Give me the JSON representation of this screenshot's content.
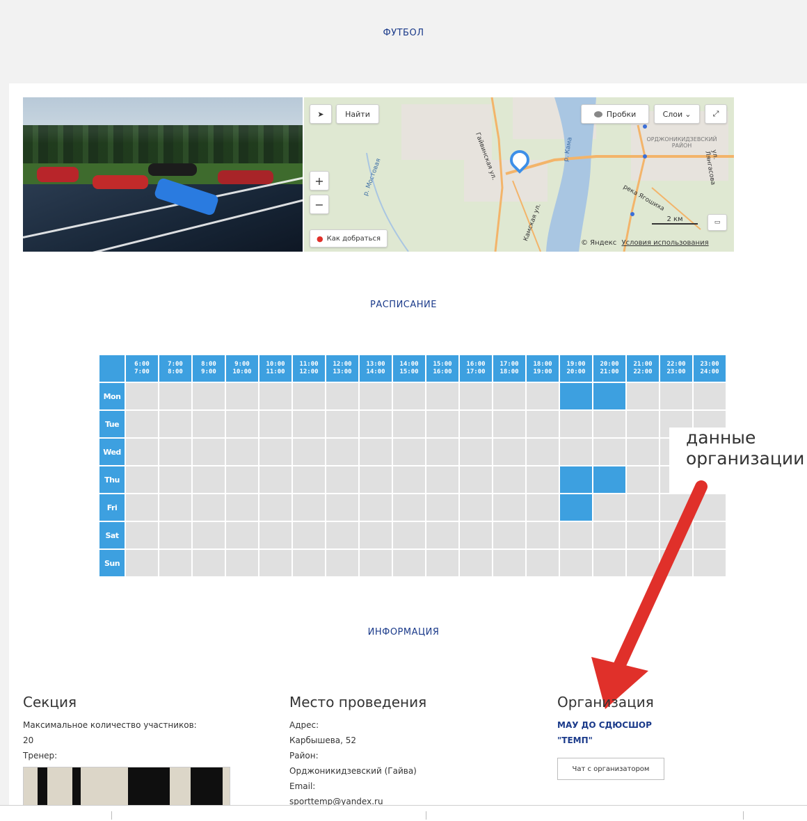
{
  "header": {
    "title": "ФУТБОЛ"
  },
  "map": {
    "find_label": "Найти",
    "traffic_label": "Пробки",
    "layers_label": "Слои",
    "zoom_in": "+",
    "zoom_out": "−",
    "route_label": "Как добраться",
    "scale_label": "2 км",
    "copyright": "© Яндекс",
    "terms_link": "Условия использования",
    "labels": {
      "river_kama": "р. Кама",
      "river_mostovaya": "р. Мостовая",
      "district": "ОРДЖОНИКИДЗЕВСКИЙ РАЙОН",
      "street_1": "Гайвинская ул.",
      "street_2": "ул. Лянгасова",
      "street_3": "река Ягошиха",
      "street_4": "Камская ул."
    }
  },
  "schedule": {
    "title": "РАСПИСАНИЕ",
    "time_slots": [
      [
        "6:00",
        "7:00"
      ],
      [
        "7:00",
        "8:00"
      ],
      [
        "8:00",
        "9:00"
      ],
      [
        "9:00",
        "10:00"
      ],
      [
        "10:00",
        "11:00"
      ],
      [
        "11:00",
        "12:00"
      ],
      [
        "12:00",
        "13:00"
      ],
      [
        "13:00",
        "14:00"
      ],
      [
        "14:00",
        "15:00"
      ],
      [
        "15:00",
        "16:00"
      ],
      [
        "16:00",
        "17:00"
      ],
      [
        "17:00",
        "18:00"
      ],
      [
        "18:00",
        "19:00"
      ],
      [
        "19:00",
        "20:00"
      ],
      [
        "20:00",
        "21:00"
      ],
      [
        "21:00",
        "22:00"
      ],
      [
        "22:00",
        "23:00"
      ],
      [
        "23:00",
        "24:00"
      ]
    ],
    "days": [
      "Mon",
      "Tue",
      "Wed",
      "Thu",
      "Fri",
      "Sat",
      "Sun"
    ],
    "active": {
      "Mon": [
        "19:00",
        "20:00"
      ],
      "Thu": [
        "19:00",
        "20:00"
      ],
      "Fri": [
        "19:00"
      ]
    }
  },
  "annotation": {
    "line1": "данные",
    "line2": "организации"
  },
  "info": {
    "title": "ИНФОРМАЦИЯ",
    "section": {
      "heading": "Секция",
      "max_label": "Максимальное количество участников:",
      "max_value": "20",
      "trainer_label": "Тренер:"
    },
    "venue": {
      "heading": "Место проведения",
      "address_label": "Адрес:",
      "address_value": "Карбышева, 52",
      "district_label": "Район:",
      "district_value": "Орджоникидзевский (Гайва)",
      "email_label": "Email:",
      "email_value": "sporttemp@yandex.ru"
    },
    "organization": {
      "heading": "Организация",
      "name_line1": "МАУ ДО СДЮСШОР",
      "name_line2": "\"ТЕМП\"",
      "chat_button": "Чат с организатором"
    }
  },
  "colors": {
    "accent": "#3da0e0",
    "cell": "#e0e0e0",
    "arrow": "#e0302a",
    "title": "#1a3a8a"
  }
}
